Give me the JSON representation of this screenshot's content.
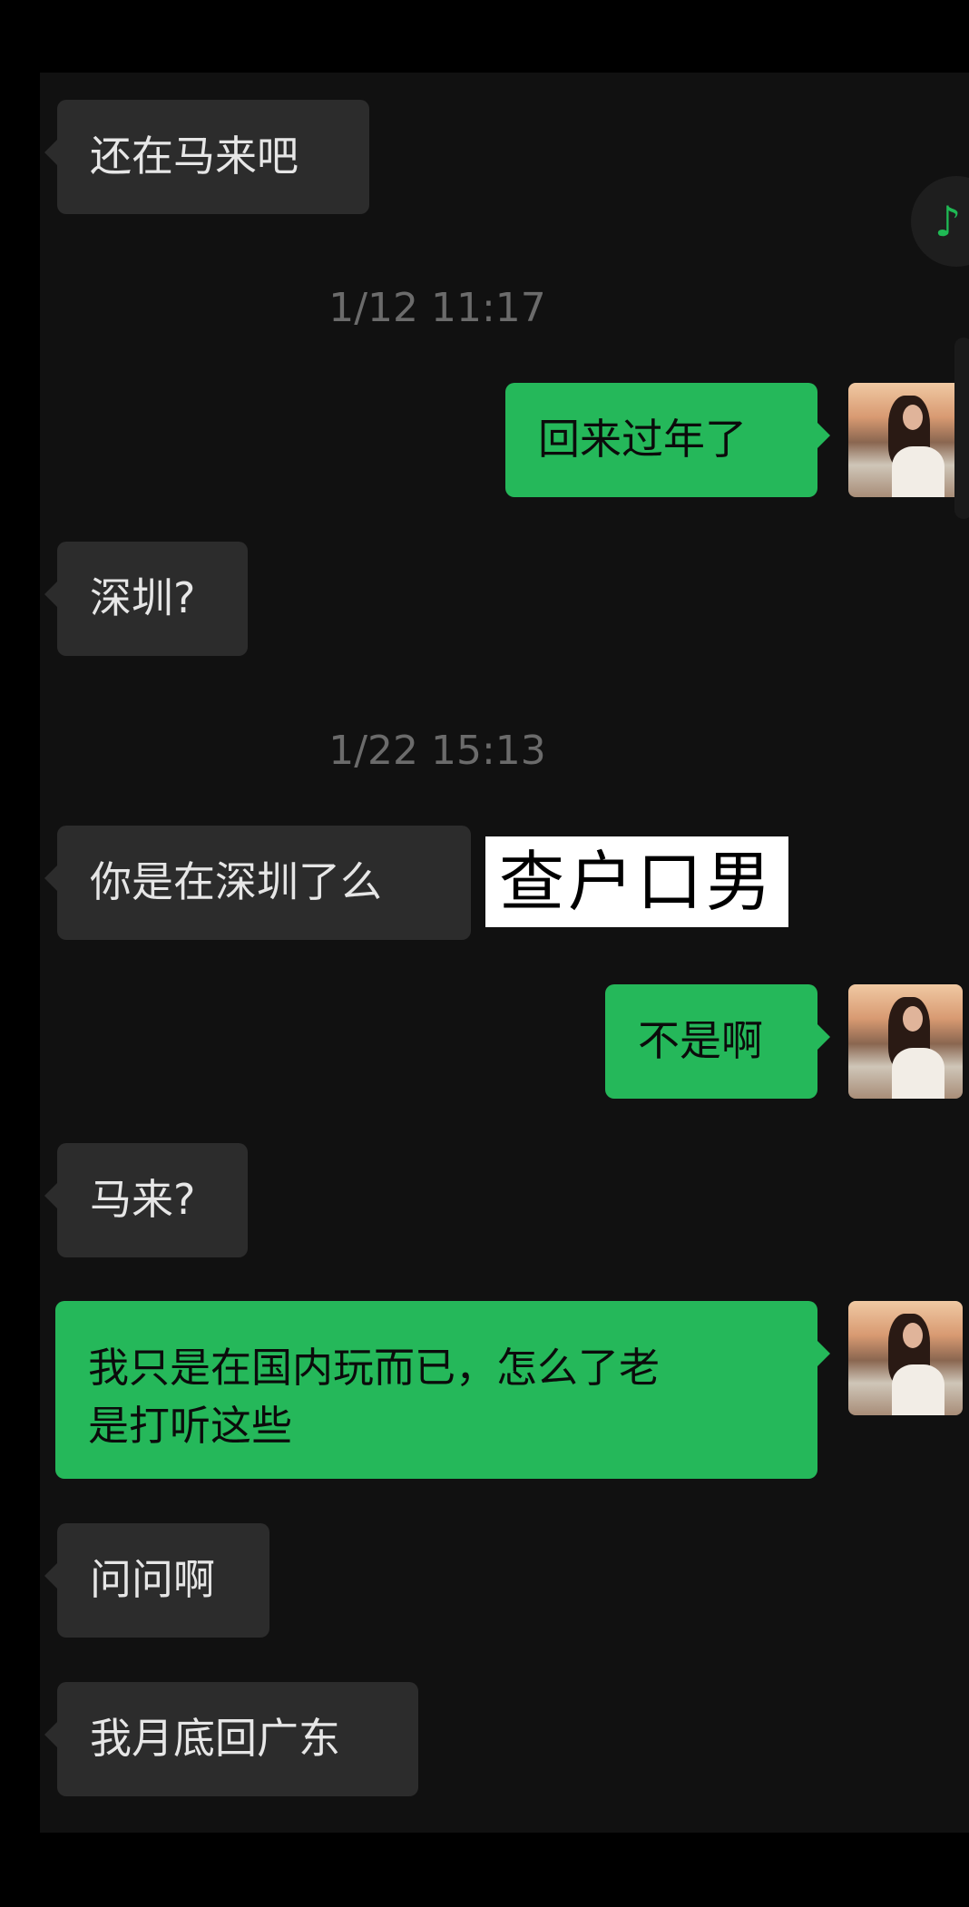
{
  "chat": {
    "messages": [
      {
        "side": "in",
        "text": "还在马来吧"
      },
      {
        "side": "time",
        "text": "1/12 11:17"
      },
      {
        "side": "out",
        "text": "回来过年了"
      },
      {
        "side": "in",
        "text": "深圳?"
      },
      {
        "side": "time",
        "text": "1/22 15:13"
      },
      {
        "side": "in",
        "text": "你是在深圳了么"
      },
      {
        "side": "out",
        "text": "不是啊"
      },
      {
        "side": "in",
        "text": "马来?"
      },
      {
        "side": "out",
        "text": "我只是在国内玩而已，怎么了老\n是打听这些"
      },
      {
        "side": "in",
        "text": "问问啊"
      },
      {
        "side": "in",
        "text": "我月底回广东"
      }
    ]
  },
  "overlay": {
    "label": "查户口男"
  },
  "music_button": {
    "icon": "music-note-icon",
    "glyph": "♪"
  },
  "colors": {
    "outgoing_bubble": "#25b85a",
    "incoming_bubble": "#2c2c2c",
    "background": "#111111",
    "timestamp": "#6b6b6b"
  }
}
